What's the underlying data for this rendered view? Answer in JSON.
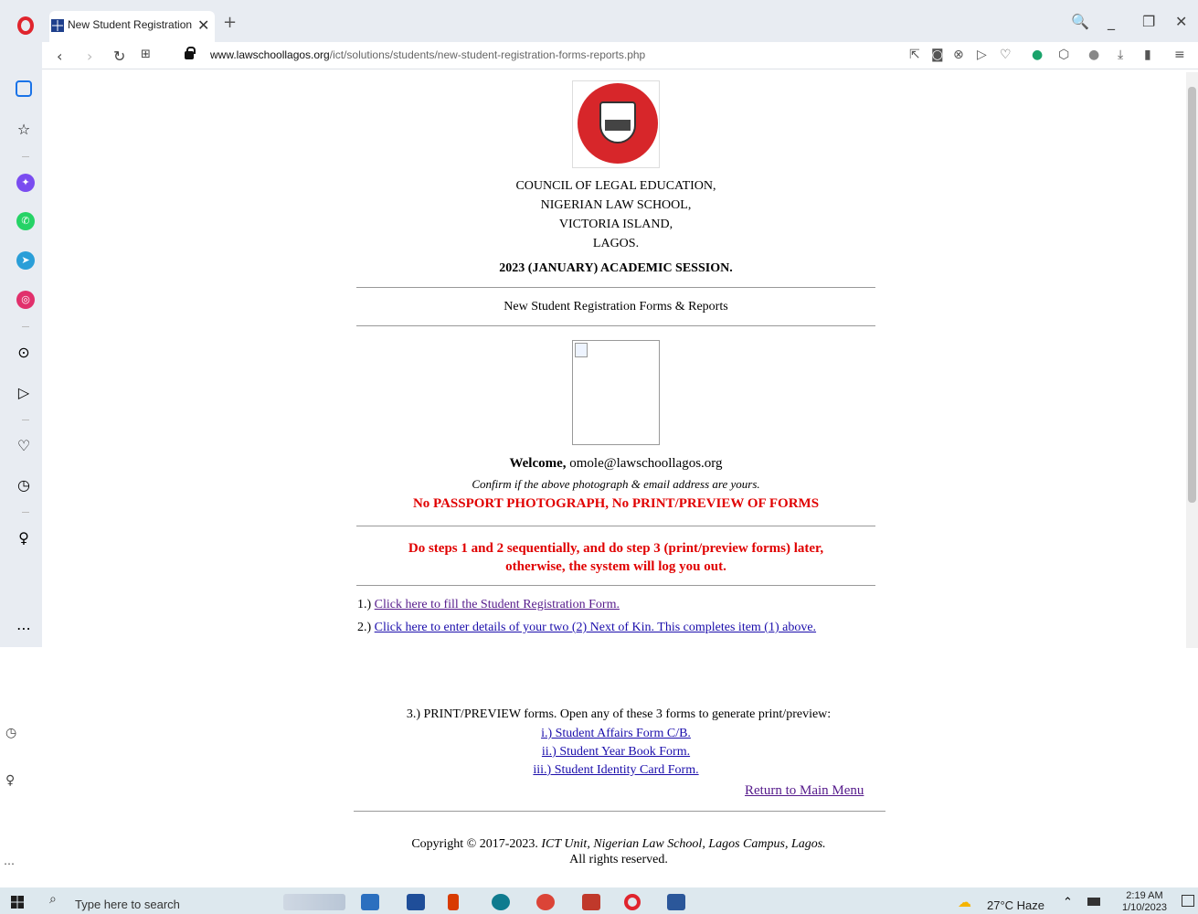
{
  "browser": {
    "tab_title": "New Student Registration F",
    "tab_close": "✕",
    "tab_new": "+",
    "url_domain": "www.lawschoollagos.org",
    "url_path": "/ict/solutions/students/new-student-registration-forms-reports.php",
    "window": {
      "search": "🔍",
      "minimize": "_",
      "restore": "❐",
      "close": "✕"
    }
  },
  "page": {
    "address_lines": [
      "COUNCIL OF LEGAL EDUCATION,",
      "NIGERIAN LAW SCHOOL,",
      "VICTORIA ISLAND,",
      "LAGOS."
    ],
    "session": "2023 (JANUARY) ACADEMIC SESSION.",
    "section_title": "New Student Registration Forms & Reports",
    "welcome_label": "Welcome,",
    "welcome_email": "omole@lawschoollagos.org",
    "confirm_note": "Confirm if the above photograph & email address are yours.",
    "passport_warning": "No PASSPORT PHOTOGRAPH, No PRINT/PREVIEW OF FORMS",
    "steps_warning_line1": "Do steps 1 and 2 sequentially, and do step 3 (print/preview forms) later,",
    "steps_warning_line2": "otherwise, the system will log you out.",
    "step1_prefix": "1.)",
    "step1_link": "Click here to fill the Student Registration Form.",
    "step2_prefix": "2.)",
    "step2_link": "Click here to enter details of your two (2) Next of Kin. This completes item (1) above.",
    "step3_text": "3.) PRINT/PREVIEW forms. Open any of these 3 forms to generate print/preview:",
    "forms": [
      "i.) Student Affairs Form C/B.",
      "ii.) Student Year Book Form.",
      "iii.) Student Identity Card Form."
    ],
    "return_link": "Return to Main Menu",
    "copyright_prefix": "Copyright © 2017-2023.",
    "copyright_unit": "ICT Unit, Nigerian Law School, Lagos Campus, Lagos.",
    "rights": "All rights reserved."
  },
  "taskbar": {
    "search_placeholder": "Type here to search",
    "weather": "27°C  Haze",
    "time": "2:19 AM",
    "date": "1/10/2023"
  },
  "colors": {
    "warning": "#e00000",
    "link": "#1a0dab",
    "sidebar": "#e8ecf2",
    "seal": "#d7262a"
  }
}
